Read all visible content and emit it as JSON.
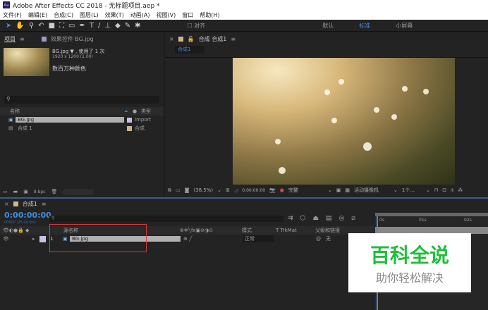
{
  "title": "Adobe After Effects CC 2018 - 无标题项目.aep *",
  "logo": "Ae",
  "menu": [
    "文件(F)",
    "编辑(E)",
    "合成(C)",
    "图层(L)",
    "效果(T)",
    "动画(A)",
    "视图(V)",
    "窗口",
    "帮助(H)"
  ],
  "toolbar": {
    "snap": "对齐",
    "workspaces": [
      "默认",
      "标准",
      "小屏幕"
    ],
    "active_workspace": "标准"
  },
  "project": {
    "tab": "项目",
    "effects_tab": "效果控件 BG.jpg",
    "item_name": "BG.jpg ▼ , 使用了 1 次",
    "item_dims": "1920 x 1200 (1.00)",
    "item_colors": "数百万种颜色",
    "col_name": "名称",
    "col_type": "类型",
    "items": [
      {
        "name": "BG.jpg",
        "type": "Import",
        "color": "#c8c0e8"
      },
      {
        "name": "合成 1",
        "type": "合成",
        "color": "#c8b88a"
      }
    ],
    "bpc": "8 bpc"
  },
  "comp": {
    "header": "合成 合成1",
    "tab": "合成1",
    "zoom": "(38.5%)",
    "timecode": "0:00:00:00",
    "quality": "完整",
    "camera": "活动摄像机",
    "views": "1个..."
  },
  "timeline": {
    "tab": "合成1",
    "timecode": "0:00:00:00",
    "fps": "00000 (25.00 fps)",
    "col_source": "源名称",
    "col_mode": "模式",
    "col_trkmat": "T  TrkMat",
    "col_parent": "父级和链接",
    "layer": {
      "num": "1",
      "name": "BG.jpg",
      "mode": "正常",
      "parent": "无"
    },
    "ruler": [
      "0s",
      "01s",
      "02s"
    ]
  },
  "watermark": {
    "title": "百科全说",
    "subtitle": "助你轻松解决",
    "color": "#1fbf3a"
  }
}
